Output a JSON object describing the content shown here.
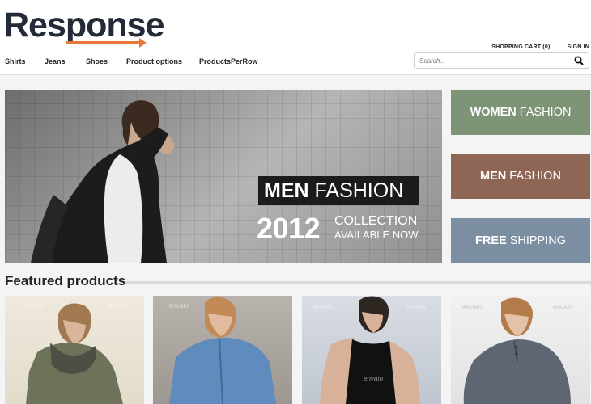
{
  "brand": {
    "name": "Response",
    "accent": "#e8783a",
    "logo_color": "#232b38"
  },
  "top_links": {
    "cart": "SHOPPING CART (0)",
    "signin": "SIGN IN"
  },
  "nav": [
    "Shirts",
    "Jeans",
    "Shoes",
    "Product options",
    "ProductsPerRow"
  ],
  "search": {
    "placeholder": "Search...",
    "icon": "search-icon"
  },
  "hero": {
    "title_bold": "MEN",
    "title_light": "FASHION",
    "year": "2012",
    "collection": "COLLECTION",
    "available": "AVAILABLE NOW"
  },
  "banners": [
    {
      "bold": "WOMEN",
      "light": "FASHION",
      "color": "#7e9477"
    },
    {
      "bold": "MEN",
      "light": "FASHION",
      "color": "#8f6655"
    },
    {
      "bold": "FREE",
      "light": "SHIPPING",
      "color": "#7c8ea2"
    }
  ],
  "featured": {
    "title": "Featured products",
    "watermark": "envato"
  }
}
